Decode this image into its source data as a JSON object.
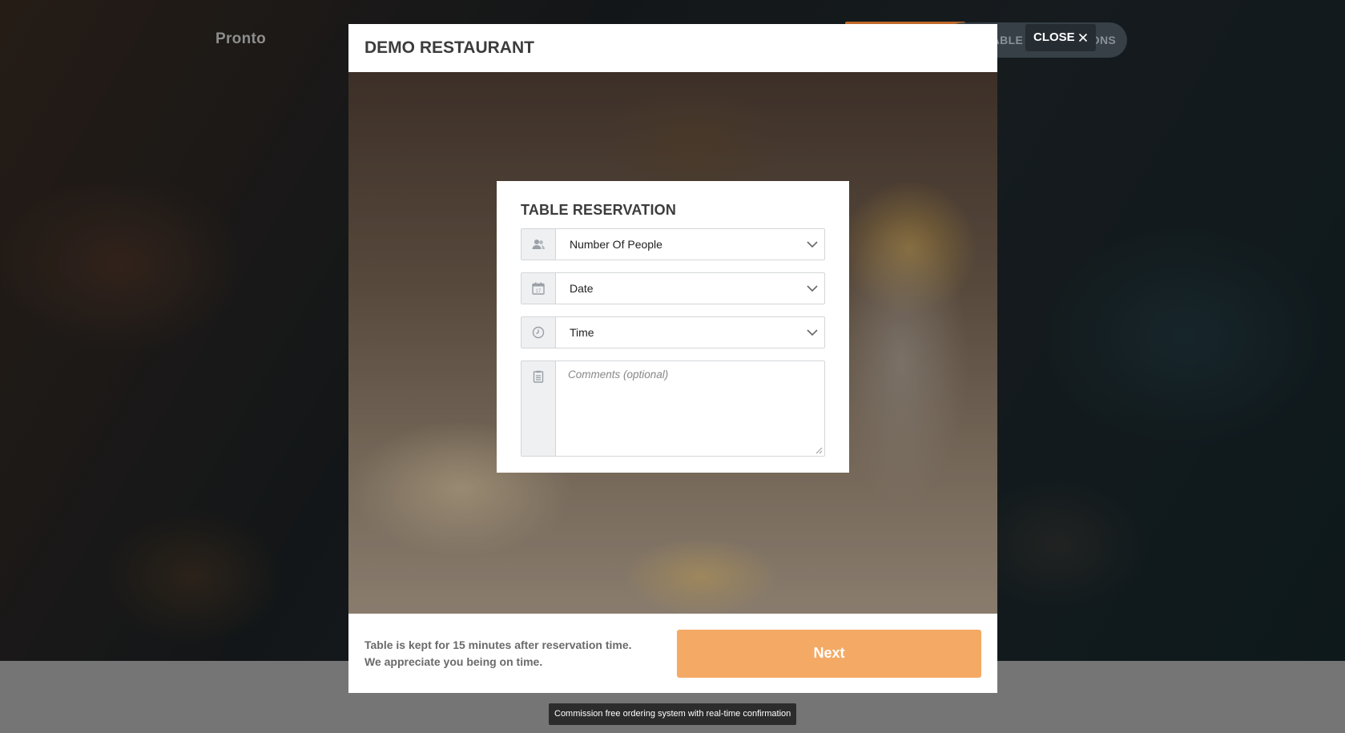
{
  "background": {
    "brand": "Pronto",
    "nav_pill_text": "ABLE RESERVATIONS"
  },
  "close_button": {
    "label": "CLOSE"
  },
  "modal": {
    "title": "DEMO RESTAURANT",
    "form": {
      "title": "TABLE RESERVATION",
      "people": {
        "value": "Number Of People",
        "icon": "people-icon"
      },
      "date": {
        "value": "Date",
        "icon": "calendar-icon"
      },
      "time": {
        "value": "Time",
        "icon": "clock-icon"
      },
      "comments": {
        "placeholder": "Comments (optional)",
        "icon": "notepad-icon"
      }
    },
    "footer": {
      "note_line1": "Table is kept for 15 minutes after reservation time.",
      "note_line2": "We appreciate you being on time.",
      "next_label": "Next"
    }
  },
  "tooltip": "Commission free ordering system with real-time confirmation",
  "colors": {
    "accent": "#f4aa65",
    "title_text": "#3c3c3c",
    "field_icon_bg": "#eef0f2"
  }
}
